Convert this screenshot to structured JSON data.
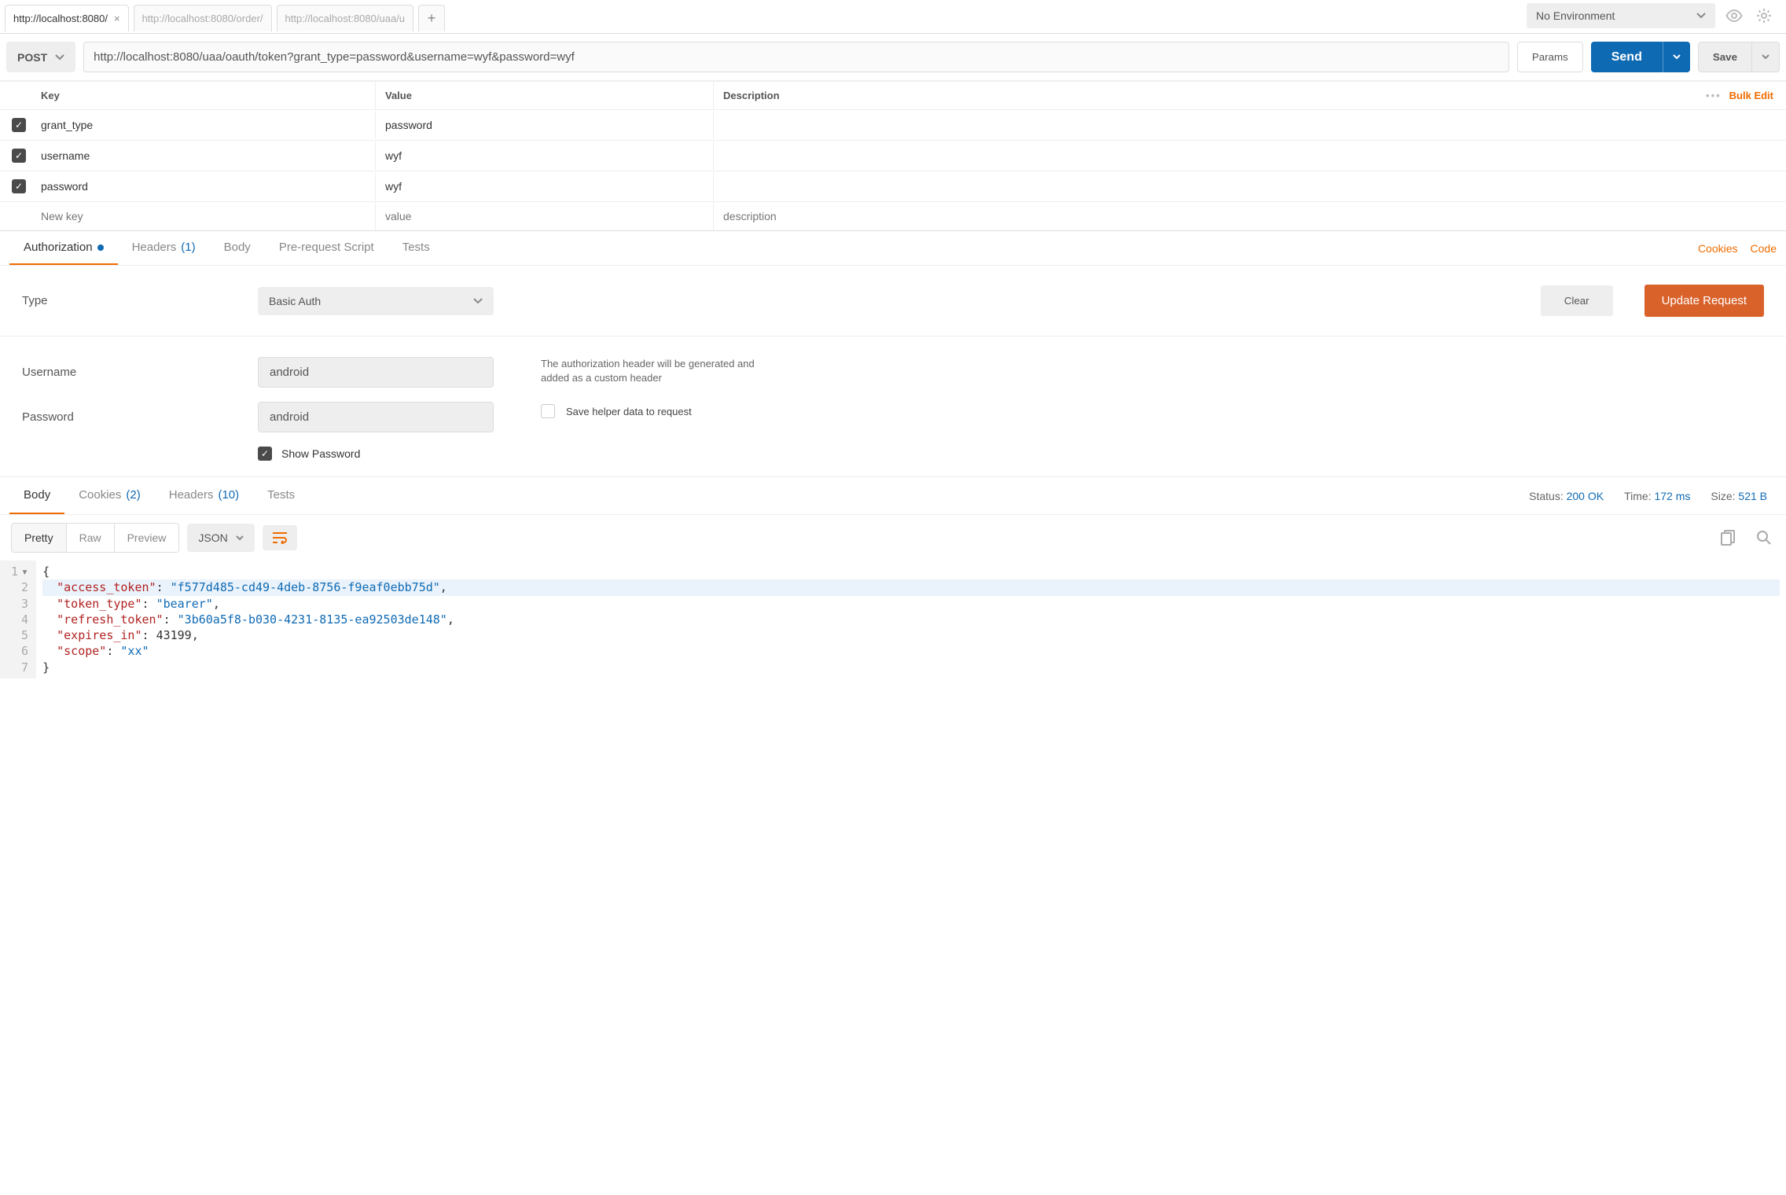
{
  "tabs": [
    {
      "label": "http://localhost:8080/",
      "active": true,
      "closable": true
    },
    {
      "label": "http://localhost:8080/order/",
      "active": false
    },
    {
      "label": "http://localhost:8080/uaa/u",
      "active": false
    }
  ],
  "environment": {
    "label": "No Environment"
  },
  "request": {
    "method": "POST",
    "url": "http://localhost:8080/uaa/oauth/token?grant_type=password&username=wyf&password=wyf",
    "params_label": "Params",
    "send_label": "Send",
    "save_label": "Save"
  },
  "params_table": {
    "headers": {
      "key": "Key",
      "value": "Value",
      "desc": "Description"
    },
    "bulk_edit": "Bulk Edit",
    "rows": [
      {
        "checked": true,
        "key": "grant_type",
        "value": "password",
        "desc": ""
      },
      {
        "checked": true,
        "key": "username",
        "value": "wyf",
        "desc": ""
      },
      {
        "checked": true,
        "key": "password",
        "value": "wyf",
        "desc": ""
      }
    ],
    "placeholder": {
      "key": "New key",
      "value": "value",
      "desc": "description"
    }
  },
  "mid_tabs": {
    "authorization": "Authorization",
    "headers": "Headers",
    "headers_count": "(1)",
    "body": "Body",
    "prerequest": "Pre-request Script",
    "tests": "Tests",
    "cookies": "Cookies",
    "code": "Code"
  },
  "auth": {
    "type_label": "Type",
    "type_value": "Basic Auth",
    "clear": "Clear",
    "update": "Update Request",
    "username_label": "Username",
    "username_value": "android",
    "password_label": "Password",
    "password_value": "android",
    "show_password": "Show Password",
    "note": "The authorization header will be generated and added as a custom header",
    "helper": "Save helper data to request"
  },
  "response_tabs": {
    "body": "Body",
    "cookies": "Cookies",
    "cookies_count": "(2)",
    "headers": "Headers",
    "headers_count": "(10)",
    "tests": "Tests"
  },
  "status": {
    "status_label": "Status:",
    "status_value": "200 OK",
    "time_label": "Time:",
    "time_value": "172 ms",
    "size_label": "Size:",
    "size_value": "521 B"
  },
  "viewer": {
    "pretty": "Pretty",
    "raw": "Raw",
    "preview": "Preview",
    "format": "JSON"
  },
  "response_body": {
    "l1": "{",
    "l2_k": "\"access_token\"",
    "l2_v": "\"f577d485-cd49-4deb-8756-f9eaf0ebb75d\"",
    "l3_k": "\"token_type\"",
    "l3_v": "\"bearer\"",
    "l4_k": "\"refresh_token\"",
    "l4_v": "\"3b60a5f8-b030-4231-8135-ea92503de148\"",
    "l5_k": "\"expires_in\"",
    "l5_v": "43199",
    "l6_k": "\"scope\"",
    "l6_v": "\"xx\"",
    "l7": "}"
  }
}
